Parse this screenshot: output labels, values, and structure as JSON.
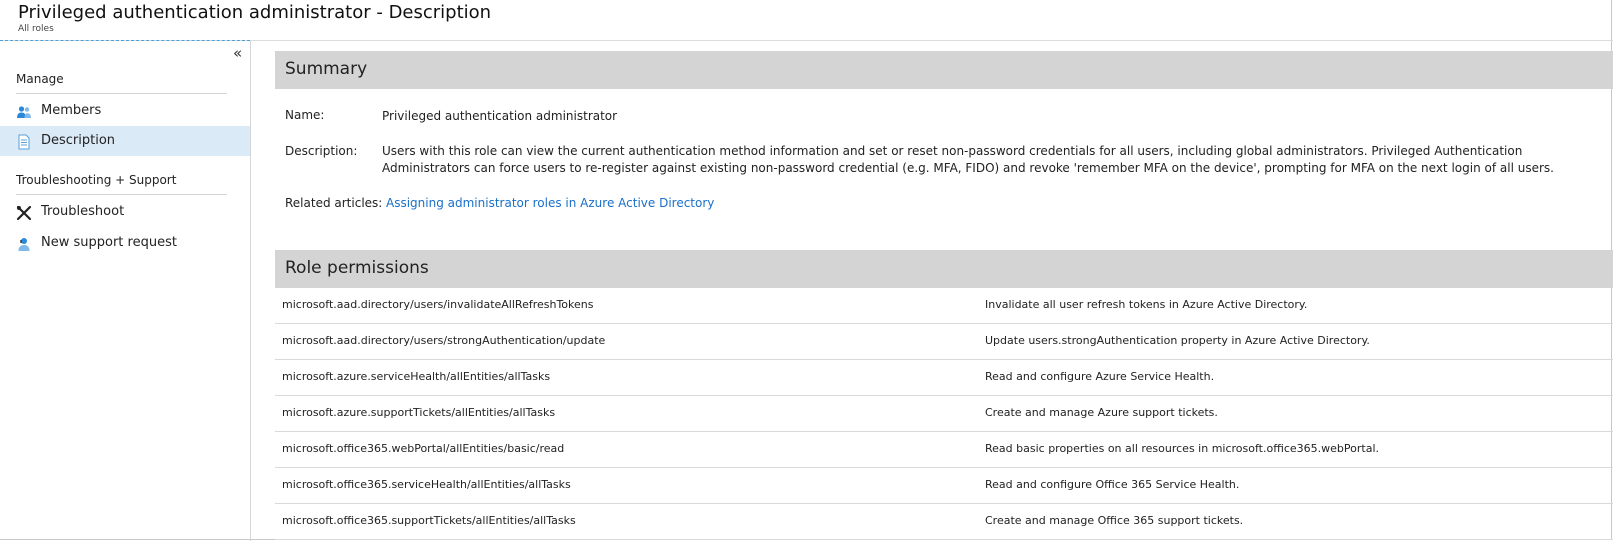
{
  "header": {
    "title": "Privileged authentication administrator - Description",
    "breadcrumb": "All roles"
  },
  "sidebar": {
    "collapse_glyph": "«",
    "sections": [
      {
        "heading": "Manage",
        "items": [
          {
            "label": "Members",
            "icon": "members-icon",
            "active": false
          },
          {
            "label": "Description",
            "icon": "document-icon",
            "active": true
          }
        ]
      },
      {
        "heading": "Troubleshooting + Support",
        "items": [
          {
            "label": "Troubleshoot",
            "icon": "wrench-icon",
            "active": false
          },
          {
            "label": "New support request",
            "icon": "support-person-icon",
            "active": false
          }
        ]
      }
    ]
  },
  "summary": {
    "heading": "Summary",
    "name_label": "Name:",
    "name_value": "Privileged authentication administrator",
    "description_label": "Description:",
    "description_value": "Users with this role can view the current authentication method information and set or reset non-password credentials for all users, including global administrators. Privileged Authentication Administrators can force users to re-register against existing non-password credential (e.g. MFA, FIDO) and revoke 'remember MFA on the device', prompting for MFA on the next login of all users.",
    "related_label": "Related articles:",
    "related_link": "Assigning administrator roles in Azure Active Directory"
  },
  "permissions": {
    "heading": "Role permissions",
    "rows": [
      {
        "name": "microsoft.aad.directory/users/invalidateAllRefreshTokens",
        "description": "Invalidate all user refresh tokens in Azure Active Directory."
      },
      {
        "name": "microsoft.aad.directory/users/strongAuthentication/update",
        "description": "Update users.strongAuthentication property in Azure Active Directory."
      },
      {
        "name": "microsoft.azure.serviceHealth/allEntities/allTasks",
        "description": "Read and configure Azure Service Health."
      },
      {
        "name": "microsoft.azure.supportTickets/allEntities/allTasks",
        "description": "Create and manage Azure support tickets."
      },
      {
        "name": "microsoft.office365.webPortal/allEntities/basic/read",
        "description": "Read basic properties on all resources in microsoft.office365.webPortal."
      },
      {
        "name": "microsoft.office365.serviceHealth/allEntities/allTasks",
        "description": "Read and configure Office 365 Service Health."
      },
      {
        "name": "microsoft.office365.supportTickets/allEntities/allTasks",
        "description": "Create and manage Office 365 support tickets."
      }
    ]
  },
  "colors": {
    "accent_link": "#1a6fc9",
    "active_nav_bg": "#dbeaf7",
    "section_bar_bg": "#d4d4d4"
  }
}
